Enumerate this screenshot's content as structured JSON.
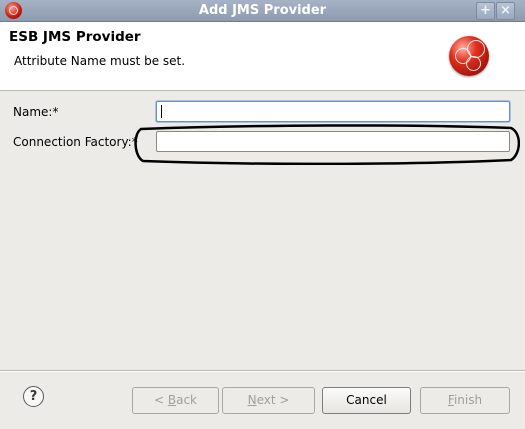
{
  "window": {
    "title": "Add JMS Provider",
    "icon": "jboss-icon",
    "controls": [
      "+",
      "×"
    ]
  },
  "header": {
    "title": "ESB JMS Provider",
    "message": "Attribute Name must be set.",
    "logo": "jboss-logo"
  },
  "form": {
    "name_label": "Name:*",
    "name_value": "",
    "factory_label": "Connection Factory:*",
    "factory_value": ""
  },
  "buttons": {
    "help": "?",
    "back_prefix": "< ",
    "back_mnemonic": "B",
    "back_rest": "ack",
    "next_mnemonic": "N",
    "next_rest": "ext >",
    "cancel": "Cancel",
    "finish_mnemonic": "F",
    "finish_rest": "inish"
  }
}
